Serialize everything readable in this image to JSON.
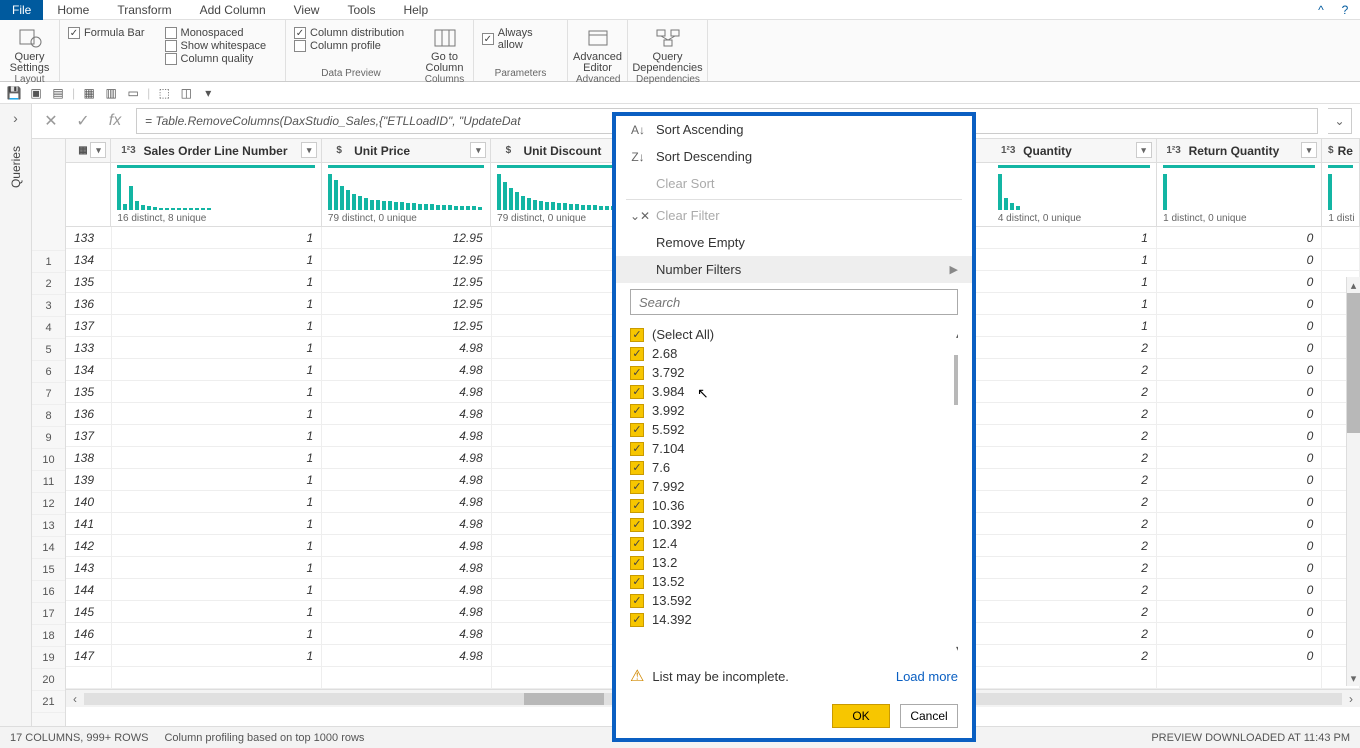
{
  "menu": {
    "file": "File",
    "items": [
      "Home",
      "Transform",
      "Add Column",
      "View",
      "Tools",
      "Help"
    ]
  },
  "ribbon": {
    "query_settings": "Query\nSettings",
    "formula_bar": "Formula Bar",
    "monospaced": "Monospaced",
    "show_whitespace": "Show whitespace",
    "column_quality": "Column quality",
    "column_distribution": "Column distribution",
    "column_profile": "Column profile",
    "goto_column": "Go to\nColumn",
    "always_allow": "Always allow",
    "advanced_editor": "Advanced\nEditor",
    "query_deps": "Query\nDependencies",
    "groups": {
      "layout": "Layout",
      "data_preview": "Data Preview",
      "columns": "Columns",
      "parameters": "Parameters",
      "advanced": "Advanced",
      "dependencies": "Dependencies"
    }
  },
  "queries_tab": "Queries",
  "formula": "= Table.RemoveColumns(DaxStudio_Sales,{\"ETLLoadID\", \"UpdateDat",
  "columns": {
    "first_dd": "⌄",
    "line": "Sales Order Line Number",
    "price": "Unit Price",
    "disc": "Unit Discount",
    "qty": "Quantity",
    "retqty": "Return Quantity",
    "ret": "Re"
  },
  "dtype_icons": {
    "int": "1²3",
    "dec": "$"
  },
  "dist": {
    "line": "16 distinct, 8 unique",
    "price": "79 distinct, 0 unique",
    "disc": "79 distinct, 0 unique",
    "qty": "4 distinct, 0 unique",
    "retqty": "1 distinct, 0 unique",
    "ret": "1 disti"
  },
  "rows": [
    {
      "n": 1,
      "id": "133",
      "line": "1",
      "price": "12.95",
      "qty": "1",
      "ret": "0"
    },
    {
      "n": 2,
      "id": "134",
      "line": "1",
      "price": "12.95",
      "qty": "1",
      "ret": "0"
    },
    {
      "n": 3,
      "id": "135",
      "line": "1",
      "price": "12.95",
      "qty": "1",
      "ret": "0"
    },
    {
      "n": 4,
      "id": "136",
      "line": "1",
      "price": "12.95",
      "qty": "1",
      "ret": "0"
    },
    {
      "n": 5,
      "id": "137",
      "line": "1",
      "price": "12.95",
      "qty": "1",
      "ret": "0"
    },
    {
      "n": 6,
      "id": "133",
      "line": "1",
      "price": "4.98",
      "qty": "2",
      "ret": "0"
    },
    {
      "n": 7,
      "id": "134",
      "line": "1",
      "price": "4.98",
      "qty": "2",
      "ret": "0"
    },
    {
      "n": 8,
      "id": "135",
      "line": "1",
      "price": "4.98",
      "qty": "2",
      "ret": "0"
    },
    {
      "n": 9,
      "id": "136",
      "line": "1",
      "price": "4.98",
      "qty": "2",
      "ret": "0"
    },
    {
      "n": 10,
      "id": "137",
      "line": "1",
      "price": "4.98",
      "qty": "2",
      "ret": "0"
    },
    {
      "n": 11,
      "id": "138",
      "line": "1",
      "price": "4.98",
      "qty": "2",
      "ret": "0"
    },
    {
      "n": 12,
      "id": "139",
      "line": "1",
      "price": "4.98",
      "qty": "2",
      "ret": "0"
    },
    {
      "n": 13,
      "id": "140",
      "line": "1",
      "price": "4.98",
      "qty": "2",
      "ret": "0"
    },
    {
      "n": 14,
      "id": "141",
      "line": "1",
      "price": "4.98",
      "qty": "2",
      "ret": "0"
    },
    {
      "n": 15,
      "id": "142",
      "line": "1",
      "price": "4.98",
      "qty": "2",
      "ret": "0"
    },
    {
      "n": 16,
      "id": "143",
      "line": "1",
      "price": "4.98",
      "qty": "2",
      "ret": "0"
    },
    {
      "n": 17,
      "id": "144",
      "line": "1",
      "price": "4.98",
      "qty": "2",
      "ret": "0"
    },
    {
      "n": 18,
      "id": "145",
      "line": "1",
      "price": "4.98",
      "qty": "2",
      "ret": "0"
    },
    {
      "n": 19,
      "id": "146",
      "line": "1",
      "price": "4.98",
      "qty": "2",
      "ret": "0"
    },
    {
      "n": 20,
      "id": "147",
      "line": "1",
      "price": "4.98",
      "qty": "2",
      "ret": "0"
    },
    {
      "n": 21,
      "id": "",
      "line": "",
      "price": "",
      "qty": "",
      "ret": ""
    }
  ],
  "filter": {
    "sort_asc": "Sort Ascending",
    "sort_desc": "Sort Descending",
    "clear_sort": "Clear Sort",
    "clear_filter": "Clear Filter",
    "remove_empty": "Remove Empty",
    "number_filters": "Number Filters",
    "search_placeholder": "Search",
    "select_all": "(Select All)",
    "values": [
      "2.68",
      "3.792",
      "3.984",
      "3.992",
      "5.592",
      "7.104",
      "7.6",
      "7.992",
      "10.36",
      "10.392",
      "12.4",
      "13.2",
      "13.52",
      "13.592",
      "14.392"
    ],
    "incomplete": "List may be incomplete.",
    "load_more": "Load more",
    "ok": "OK",
    "cancel": "Cancel"
  },
  "status": {
    "left": "17 COLUMNS, 999+ ROWS",
    "mid": "Column profiling based on top 1000 rows",
    "right": "PREVIEW DOWNLOADED AT 11:43 PM"
  }
}
